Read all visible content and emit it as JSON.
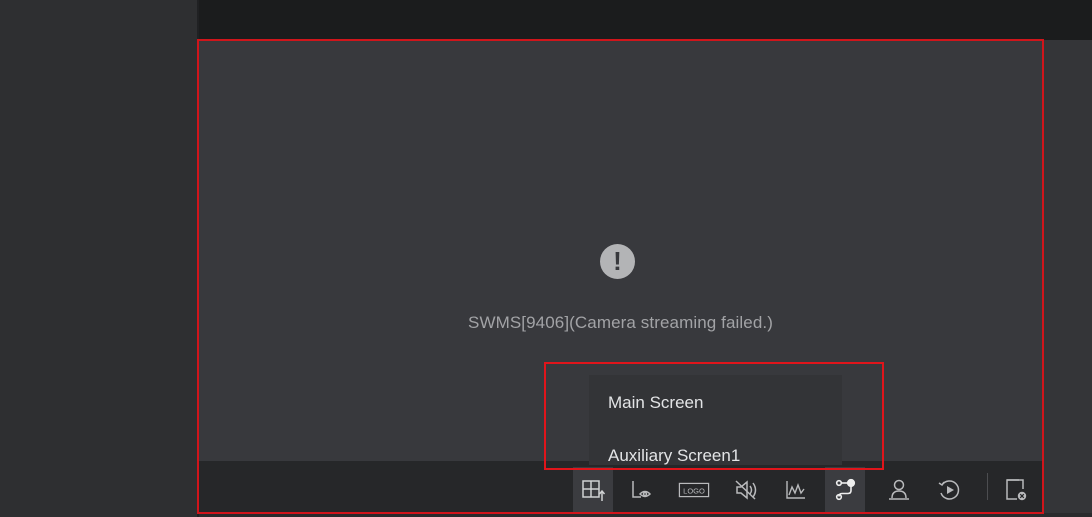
{
  "video": {
    "error_message": "SWMS[9406](Camera streaming failed.)",
    "error_icon": "exclamation-circle-icon"
  },
  "screen_menu": {
    "items": [
      {
        "label": "Main Screen"
      },
      {
        "label": "Auxiliary Screen1"
      }
    ]
  },
  "toolbar": {
    "buttons": [
      {
        "icon": "window-layout-icon",
        "active": true
      },
      {
        "icon": "privacy-mask-icon"
      },
      {
        "icon": "logo-overlay-icon",
        "text": "LOGO"
      },
      {
        "icon": "mute-icon"
      },
      {
        "icon": "waveform-icon"
      },
      {
        "icon": "output-screen-icon",
        "active": true
      },
      {
        "icon": "person-icon"
      },
      {
        "icon": "playback-icon"
      },
      {
        "icon": "close-window-icon"
      }
    ]
  },
  "colors": {
    "highlight_border": "#e0151b",
    "pane_background": "#38393d",
    "toolbar_background": "#262729"
  }
}
